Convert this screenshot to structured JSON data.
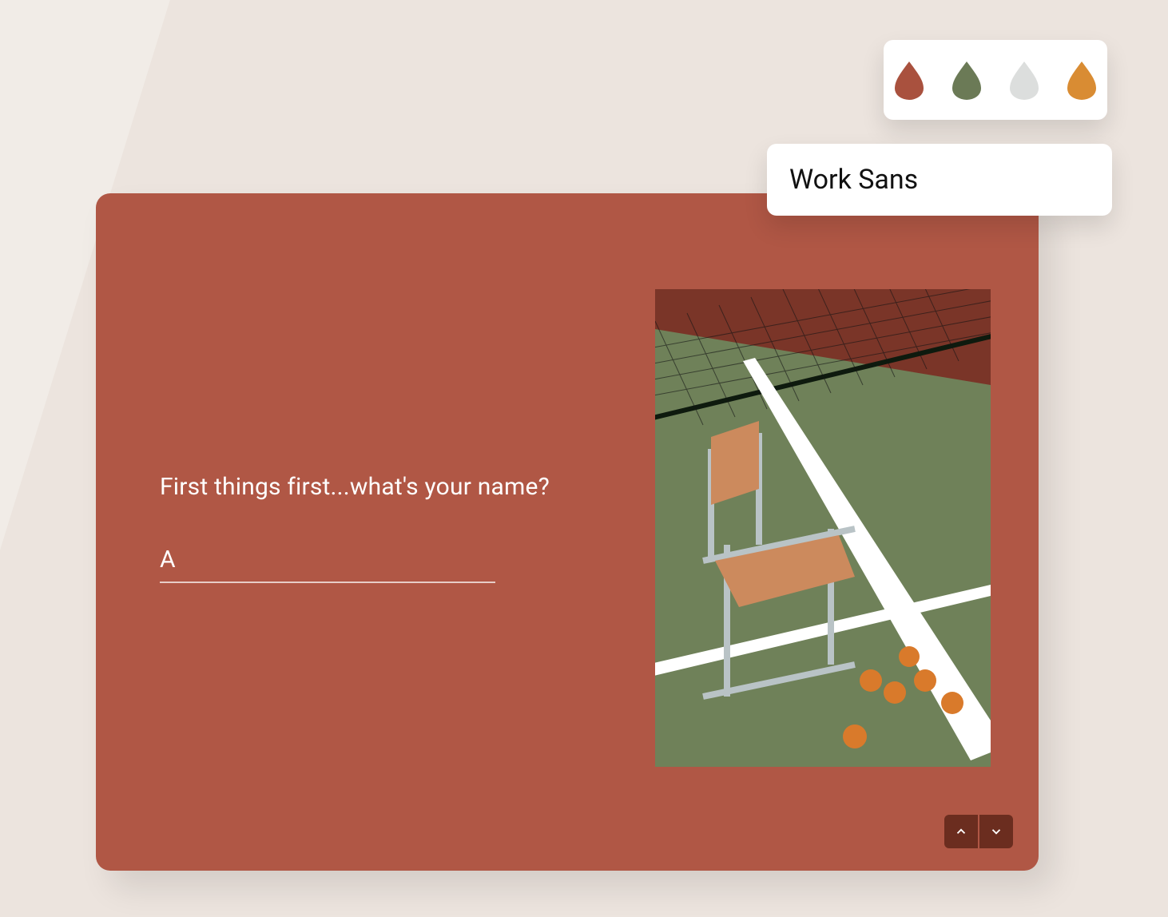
{
  "palette": {
    "swatches": [
      "#a9513e",
      "#6b7a56",
      "#dcdedd",
      "#d98c33"
    ]
  },
  "font_picker": {
    "selected": "Work Sans"
  },
  "form": {
    "accent_color": "#b05745",
    "question": "First things first...what's your name?",
    "answer_value": "A",
    "answer_placeholder": ""
  },
  "nav": {
    "up": "previous question",
    "down": "next question"
  },
  "photo": {
    "alt": "Orange folding chair on a green tennis court with scattered oranges"
  }
}
